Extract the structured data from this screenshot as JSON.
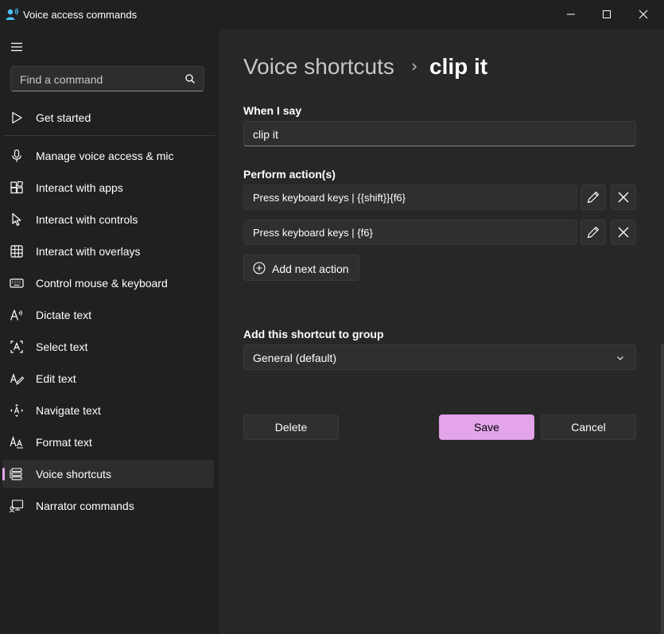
{
  "window": {
    "title": "Voice access commands"
  },
  "sidebar": {
    "search_placeholder": "Find a command",
    "items": [
      {
        "label": "Get started",
        "icon": "play-icon"
      },
      {
        "label": "Manage voice access & mic",
        "icon": "microphone-icon"
      },
      {
        "label": "Interact with apps",
        "icon": "apps-icon"
      },
      {
        "label": "Interact with controls",
        "icon": "cursor-icon"
      },
      {
        "label": "Interact with overlays",
        "icon": "grid-icon"
      },
      {
        "label": "Control mouse & keyboard",
        "icon": "keyboard-icon"
      },
      {
        "label": "Dictate text",
        "icon": "dictate-icon"
      },
      {
        "label": "Select text",
        "icon": "select-text-icon"
      },
      {
        "label": "Edit text",
        "icon": "edit-text-icon"
      },
      {
        "label": "Navigate text",
        "icon": "navigate-text-icon"
      },
      {
        "label": "Format text",
        "icon": "format-text-icon"
      },
      {
        "label": "Voice shortcuts",
        "icon": "voice-shortcuts-icon",
        "selected": true
      },
      {
        "label": "Narrator commands",
        "icon": "narrator-icon"
      }
    ]
  },
  "main": {
    "breadcrumb_parent": "Voice shortcuts",
    "breadcrumb_current": "clip it",
    "when_i_say_label": "When I say",
    "when_i_say_value": "clip it",
    "perform_actions_label": "Perform action(s)",
    "actions": [
      {
        "text": "Press keyboard keys | {{shift}}{f6}"
      },
      {
        "text": "Press keyboard keys | {f6}"
      }
    ],
    "add_action_label": "Add next action",
    "group_label": "Add this shortcut to group",
    "group_value": "General (default)",
    "delete_label": "Delete",
    "save_label": "Save",
    "cancel_label": "Cancel"
  },
  "colors": {
    "accent": "#e3a4e9",
    "background": "#202020",
    "panel": "#272727",
    "control": "#2f2f2f"
  }
}
